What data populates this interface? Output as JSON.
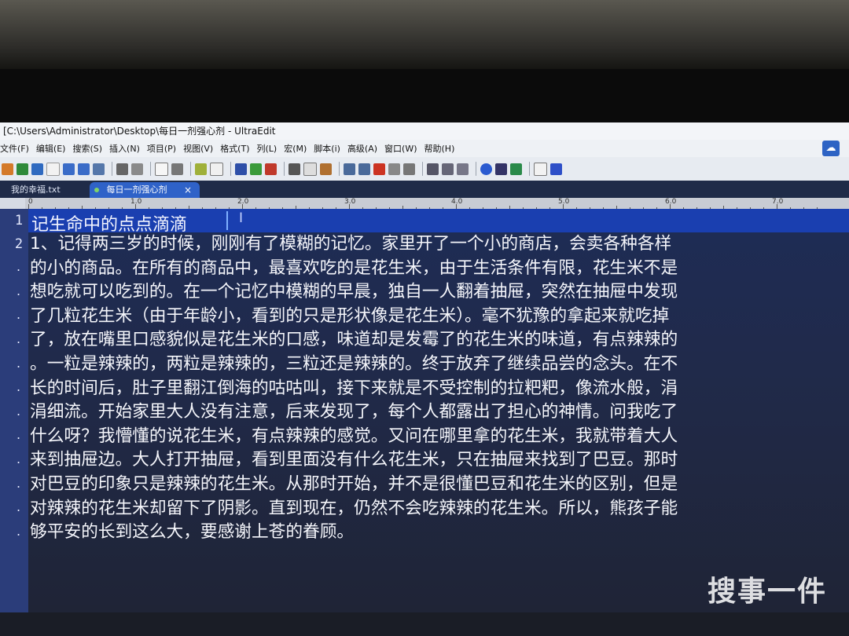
{
  "window": {
    "title": "[C:\\Users\\Administrator\\Desktop\\每日一剂强心剂 - UltraEdit"
  },
  "menu": [
    "文件(F)",
    "编辑(E)",
    "搜索(S)",
    "插入(N)",
    "项目(P)",
    "视图(V)",
    "格式(T)",
    "列(L)",
    "宏(M)",
    "脚本(i)",
    "高级(A)",
    "窗口(W)",
    "帮助(H)"
  ],
  "tabs": [
    {
      "label": "我的幸福.txt"
    },
    {
      "label": "每日一剂强心剂",
      "close": "×"
    }
  ],
  "tab_close": "×",
  "ruler": [
    "0",
    "1.0",
    "2.0",
    "3.0",
    "4.0",
    "5.0",
    "6.0",
    "7.0"
  ],
  "gutter": {
    "line1": "1",
    "line2": "2"
  },
  "editor": {
    "line1": "记生命中的点点滴滴",
    "lines": [
      "1、记得两三岁的时候，刚刚有了模糊的记忆。家里开了一个小的商店，会卖各种各样",
      "的小的商品。在所有的商品中，最喜欢吃的是花生米，由于生活条件有限，花生米不是",
      "想吃就可以吃到的。在一个记忆中模糊的早晨，独自一人翻着抽屉，突然在抽屉中发现",
      "了几粒花生米（由于年龄小，看到的只是形状像是花生米）。毫不犹豫的拿起来就吃掉",
      "了，放在嘴里口感貌似是花生米的口感，味道却是发霉了的花生米的味道，有点辣辣的",
      "。一粒是辣辣的，两粒是辣辣的，三粒还是辣辣的。终于放弃了继续品尝的念头。在不",
      "长的时间后，肚子里翻江倒海的咕咕叫，接下来就是不受控制的拉粑粑，像流水般，涓",
      "涓细流。开始家里大人没有注意，后来发现了，每个人都露出了担心的神情。问我吃了",
      "什么呀？我懵懂的说花生米，有点辣辣的感觉。又问在哪里拿的花生米，我就带着大人",
      "来到抽屉边。大人打开抽屉，看到里面没有什么花生米，只在抽屉来找到了巴豆。那时",
      "对巴豆的印象只是辣辣的花生米。从那时开始，并不是很懂巴豆和花生米的区别，但是",
      "对辣辣的花生米却留下了阴影。直到现在，仍然不会吃辣辣的花生米。所以，熊孩子能",
      "够平安的长到这么大，要感谢上苍的眷顾。"
    ]
  },
  "watermark": "搜事一件",
  "colors": {
    "gutter": "#2b3d7a",
    "editor_bg": "#1e2c56",
    "current_line": "#1a3fb0",
    "active_tab": "#2f62c8"
  }
}
